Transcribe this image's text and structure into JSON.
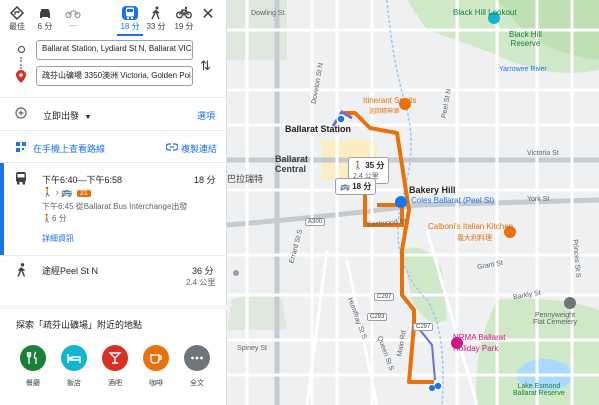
{
  "modes": [
    {
      "id": "best",
      "label": "最佳"
    },
    {
      "id": "car",
      "label": "6 分"
    },
    {
      "id": "motorbike",
      "label": "—"
    },
    {
      "id": "transit",
      "label": "18 分"
    },
    {
      "id": "walk",
      "label": "33 分"
    },
    {
      "id": "bike",
      "label": "19 分"
    }
  ],
  "close_glyph": "✕",
  "swap_glyph": "⇅",
  "origin_value": "Ballarat Station, Lydiard St N, Ballarat VIC",
  "destination_value": "疏芬山礦場 3350澳洲 Victoria, Golden Poi",
  "depart_label": "立即出發",
  "options_label": "選項",
  "send_to_phone": "在手機上查看路線",
  "copy_link": "複製連結",
  "route1": {
    "time_range": "下午6:40—下午6:58",
    "duration": "18 分",
    "bus_number": "21",
    "depart_info": "下午6:45 從Ballarat Bus Interchange出發",
    "walk_info": "6 分",
    "details_link": "詳細資訊"
  },
  "route2": {
    "label": "途經Peel St N",
    "duration": "36 分",
    "distance": "2.4 公里"
  },
  "explore_title": "探索「疏芬山礦場」附近的地點",
  "explore": [
    {
      "id": "restaurant",
      "label": "餐廳",
      "color": "#188038"
    },
    {
      "id": "hotel",
      "label": "飯店",
      "color": "#12b5cb"
    },
    {
      "id": "bar",
      "label": "酒吧",
      "color": "#d93025"
    },
    {
      "id": "cafe",
      "label": "咖啡",
      "color": "#e8710a"
    },
    {
      "id": "more",
      "label": "全文",
      "color": "#70757a"
    }
  ],
  "map_labels": {
    "black_hill_lookout": "Black Hill Lookout",
    "black_hill_reserve": "Black Hill\nReserve",
    "yarrowee_river": "Yarrowee River",
    "itinerant_spirits": "Itinerant Spirits",
    "itinerant_spirits_cn": "巡回精神酒",
    "ballarat_station": "Ballarat Station",
    "ballarat_central": "Ballarat\nCentral",
    "ballarat_cn": "巴拉瑞特",
    "bakery_hill": "Bakery Hill",
    "coles": "Coles Ballarat (Peel St)",
    "calboni": "Calboni's Italian Kitchen",
    "calboni_cn": "義大利料理",
    "nrma": "NRMA Ballarat",
    "nrma2": "Holiday Park",
    "pennyweight": "Pennyweight\nFlat Cemetery",
    "lake_esmond": "Lake Esmond\nBallarat Reserve",
    "dowling": "Dowling St",
    "doveton": "Doveton St N",
    "eastwood": "Eastwood St",
    "humffray": "Humffray St S",
    "grant": "Grant St",
    "barkly": "Barkly St",
    "spiney": "Spiney St",
    "queen": "Queen St S",
    "princes": "Princes St S",
    "peel": "Peel St N",
    "main": "Main Rd",
    "york": "York St",
    "errard": "Errard St S",
    "victoria": "Victoria St"
  },
  "road_numbers": [
    "A300",
    "C297",
    "C297",
    "C293"
  ],
  "walk_callout": {
    "time": "35 分",
    "distance": "2.4 公里"
  },
  "bus_callout": {
    "time": "18 分"
  }
}
